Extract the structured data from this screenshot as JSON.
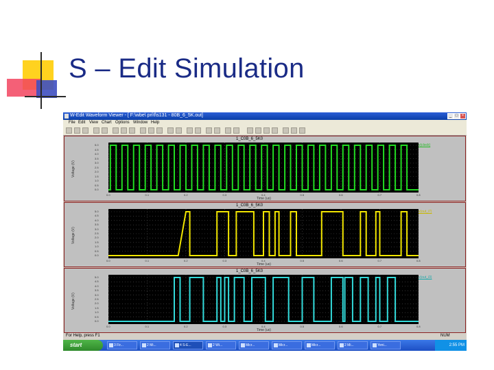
{
  "slide": {
    "title": "S – Edit Simulation"
  },
  "window": {
    "title": "W-Edit Waveform Viewer - [ F:\\wbe\\ pri\\f\\s131 - 80B_6_5K.out]",
    "menu": [
      "File",
      "Edit",
      "View",
      "Chart",
      "Options",
      "Window",
      "Help"
    ],
    "buttons": {
      "minimize": "_",
      "maximize": "□",
      "close": "×"
    }
  },
  "panels": [
    {
      "title": "1_C0B_6_5K0",
      "legend": "v(clock)",
      "xlabel": "Time (us)",
      "ylabel": "Voltage (V)",
      "color": "#22dd22",
      "yticks": [
        "5.0",
        "4.5",
        "4.0",
        "3.5",
        "3.0",
        "2.5",
        "2.0",
        "1.5",
        "1.0",
        "0.5",
        "0.0"
      ],
      "xticks": [
        "0.0",
        "0.1",
        "0.2",
        "0.3",
        "0.4",
        "0.5",
        "0.6",
        "0.7",
        "0.8"
      ]
    },
    {
      "title": "1_C0B_6_5K0",
      "legend": "v(out_i7)",
      "xlabel": "Time (us)",
      "ylabel": "Voltage (V)",
      "color": "#f2e600",
      "yticks": [
        "5.0",
        "4.5",
        "4.0",
        "3.5",
        "3.0",
        "2.5",
        "2.0",
        "1.5",
        "1.0",
        "0.5",
        "0.0"
      ],
      "xticks": [
        "0.0",
        "0.1",
        "0.2",
        "0.3",
        "0.4",
        "0.5",
        "0.6",
        "0.7",
        "0.8"
      ]
    },
    {
      "title": "1_C0B_6_5K0",
      "legend": "v(out_i3)",
      "xlabel": "Time (us)",
      "ylabel": "Voltage (V)",
      "color": "#33dddd",
      "yticks": [
        "5.0",
        "4.5",
        "4.0",
        "3.5",
        "3.0",
        "2.5",
        "2.0",
        "1.5",
        "1.0",
        "0.5",
        "0.0"
      ],
      "xticks": [
        "0.0",
        "0.1",
        "0.2",
        "0.3",
        "0.4",
        "0.5",
        "0.6",
        "0.7",
        "0.8"
      ]
    }
  ],
  "chart_data": [
    {
      "type": "line",
      "title": "1_C0B_6_5K0",
      "xlabel": "Time (us)",
      "ylabel": "Voltage (V)",
      "xlim": [
        0,
        0.8
      ],
      "ylim": [
        0,
        5
      ],
      "series": [
        {
          "name": "v(clock)",
          "points": [
            [
              0,
              0
            ],
            [
              0.005,
              0
            ],
            [
              0.005,
              5
            ],
            [
              0.02,
              5
            ],
            [
              0.02,
              0
            ],
            [
              0.035,
              0
            ],
            [
              0.035,
              5
            ],
            [
              0.05,
              5
            ],
            [
              0.05,
              0
            ],
            [
              0.065,
              0
            ],
            [
              0.065,
              5
            ],
            [
              0.08,
              5
            ],
            [
              0.08,
              0
            ],
            [
              0.095,
              0
            ],
            [
              0.095,
              5
            ],
            [
              0.11,
              5
            ],
            [
              0.11,
              0
            ],
            [
              0.125,
              0
            ],
            [
              0.125,
              5
            ],
            [
              0.14,
              5
            ],
            [
              0.14,
              0
            ],
            [
              0.155,
              0
            ],
            [
              0.155,
              5
            ],
            [
              0.17,
              5
            ],
            [
              0.17,
              0
            ],
            [
              0.185,
              0
            ],
            [
              0.185,
              5
            ],
            [
              0.2,
              5
            ],
            [
              0.2,
              0
            ],
            [
              0.215,
              0
            ],
            [
              0.215,
              5
            ],
            [
              0.23,
              5
            ],
            [
              0.23,
              0
            ],
            [
              0.245,
              0
            ],
            [
              0.245,
              5
            ],
            [
              0.26,
              5
            ],
            [
              0.26,
              0
            ],
            [
              0.275,
              0
            ],
            [
              0.275,
              5
            ],
            [
              0.29,
              5
            ],
            [
              0.29,
              0
            ],
            [
              0.305,
              0
            ],
            [
              0.305,
              5
            ],
            [
              0.32,
              5
            ],
            [
              0.32,
              0
            ],
            [
              0.335,
              0
            ],
            [
              0.335,
              5
            ],
            [
              0.35,
              5
            ],
            [
              0.35,
              0
            ],
            [
              0.365,
              0
            ],
            [
              0.365,
              5
            ],
            [
              0.38,
              5
            ],
            [
              0.38,
              0
            ],
            [
              0.395,
              0
            ],
            [
              0.395,
              5
            ],
            [
              0.41,
              5
            ],
            [
              0.41,
              0
            ],
            [
              0.425,
              0
            ],
            [
              0.425,
              5
            ],
            [
              0.44,
              5
            ],
            [
              0.44,
              0
            ],
            [
              0.455,
              0
            ],
            [
              0.455,
              5
            ],
            [
              0.47,
              5
            ],
            [
              0.47,
              0
            ],
            [
              0.485,
              0
            ],
            [
              0.485,
              5
            ],
            [
              0.5,
              5
            ],
            [
              0.5,
              0
            ],
            [
              0.515,
              0
            ],
            [
              0.515,
              5
            ],
            [
              0.53,
              5
            ],
            [
              0.53,
              0
            ],
            [
              0.545,
              0
            ],
            [
              0.545,
              5
            ],
            [
              0.56,
              5
            ],
            [
              0.56,
              0
            ],
            [
              0.575,
              0
            ],
            [
              0.575,
              5
            ],
            [
              0.59,
              5
            ],
            [
              0.59,
              0
            ],
            [
              0.605,
              0
            ],
            [
              0.605,
              5
            ],
            [
              0.62,
              5
            ],
            [
              0.62,
              0
            ],
            [
              0.635,
              0
            ],
            [
              0.635,
              5
            ],
            [
              0.65,
              5
            ],
            [
              0.65,
              0
            ],
            [
              0.665,
              0
            ],
            [
              0.665,
              5
            ],
            [
              0.68,
              5
            ],
            [
              0.68,
              0
            ],
            [
              0.695,
              0
            ],
            [
              0.695,
              5
            ],
            [
              0.71,
              5
            ],
            [
              0.71,
              0
            ],
            [
              0.725,
              0
            ],
            [
              0.725,
              5
            ],
            [
              0.74,
              5
            ],
            [
              0.74,
              0
            ],
            [
              0.755,
              0
            ],
            [
              0.755,
              5
            ],
            [
              0.77,
              5
            ],
            [
              0.77,
              0
            ],
            [
              0.8,
              0
            ]
          ]
        }
      ]
    },
    {
      "type": "line",
      "title": "1_C0B_6_5K0",
      "xlabel": "Time (us)",
      "ylabel": "Voltage (V)",
      "xlim": [
        0,
        0.8
      ],
      "ylim": [
        0,
        5
      ],
      "series": [
        {
          "name": "v(out_i7)",
          "points": [
            [
              0,
              0
            ],
            [
              0.18,
              0
            ],
            [
              0.2,
              5
            ],
            [
              0.21,
              5
            ],
            [
              0.21,
              0
            ],
            [
              0.28,
              0
            ],
            [
              0.28,
              5
            ],
            [
              0.31,
              5
            ],
            [
              0.31,
              0
            ],
            [
              0.33,
              0
            ],
            [
              0.33,
              5
            ],
            [
              0.375,
              5
            ],
            [
              0.375,
              0
            ],
            [
              0.4,
              0
            ],
            [
              0.4,
              5
            ],
            [
              0.415,
              5
            ],
            [
              0.415,
              0
            ],
            [
              0.43,
              0
            ],
            [
              0.43,
              5
            ],
            [
              0.44,
              5
            ],
            [
              0.44,
              0
            ],
            [
              0.47,
              0
            ],
            [
              0.47,
              5
            ],
            [
              0.485,
              5
            ],
            [
              0.485,
              0
            ],
            [
              0.55,
              0
            ],
            [
              0.55,
              5
            ],
            [
              0.605,
              5
            ],
            [
              0.605,
              0
            ],
            [
              0.65,
              0
            ],
            [
              0.65,
              5
            ],
            [
              0.665,
              5
            ],
            [
              0.665,
              0
            ],
            [
              0.69,
              0
            ],
            [
              0.69,
              5
            ],
            [
              0.7,
              5
            ],
            [
              0.7,
              0
            ],
            [
              0.755,
              0
            ],
            [
              0.755,
              5
            ],
            [
              0.77,
              5
            ],
            [
              0.77,
              0
            ],
            [
              0.8,
              0
            ]
          ]
        }
      ]
    },
    {
      "type": "line",
      "title": "1_C0B_6_5K0",
      "xlabel": "Time (us)",
      "ylabel": "Voltage (V)",
      "xlim": [
        0,
        0.8
      ],
      "ylim": [
        0,
        5
      ],
      "series": [
        {
          "name": "v(out_i3)",
          "points": [
            [
              0,
              0
            ],
            [
              0.17,
              0
            ],
            [
              0.17,
              5
            ],
            [
              0.185,
              5
            ],
            [
              0.185,
              0
            ],
            [
              0.21,
              0
            ],
            [
              0.21,
              5
            ],
            [
              0.245,
              5
            ],
            [
              0.245,
              0
            ],
            [
              0.28,
              0
            ],
            [
              0.28,
              5
            ],
            [
              0.29,
              5
            ],
            [
              0.29,
              0
            ],
            [
              0.3,
              0
            ],
            [
              0.3,
              5
            ],
            [
              0.31,
              5
            ],
            [
              0.31,
              0
            ],
            [
              0.325,
              0
            ],
            [
              0.325,
              5
            ],
            [
              0.35,
              5
            ],
            [
              0.35,
              0
            ],
            [
              0.37,
              0
            ],
            [
              0.37,
              5
            ],
            [
              0.405,
              5
            ],
            [
              0.405,
              0
            ],
            [
              0.425,
              0
            ],
            [
              0.425,
              5
            ],
            [
              0.465,
              5
            ],
            [
              0.465,
              0
            ],
            [
              0.5,
              0
            ],
            [
              0.5,
              5
            ],
            [
              0.53,
              5
            ],
            [
              0.53,
              0
            ],
            [
              0.575,
              0
            ],
            [
              0.575,
              5
            ],
            [
              0.605,
              5
            ],
            [
              0.605,
              0
            ],
            [
              0.61,
              0
            ],
            [
              0.61,
              5
            ],
            [
              0.63,
              5
            ],
            [
              0.63,
              0
            ],
            [
              0.65,
              0
            ],
            [
              0.65,
              5
            ],
            [
              0.67,
              5
            ],
            [
              0.67,
              0
            ],
            [
              0.69,
              0
            ],
            [
              0.69,
              5
            ],
            [
              0.7,
              5
            ],
            [
              0.7,
              0
            ],
            [
              0.72,
              0
            ],
            [
              0.72,
              5
            ],
            [
              0.74,
              5
            ],
            [
              0.74,
              0
            ],
            [
              0.8,
              0
            ]
          ]
        }
      ]
    }
  ],
  "status": {
    "left": "For Help, press F1",
    "right": "NUM"
  },
  "taskbar": {
    "start": "start",
    "tasks": [
      "3 Fir...",
      "2 Mi...",
      "4 S-E...",
      "2 Wi...",
      "Micr...",
      "Micr...",
      "Micr...",
      "2 Mi...",
      "Yeni..."
    ],
    "clock": "2:55 PM"
  }
}
